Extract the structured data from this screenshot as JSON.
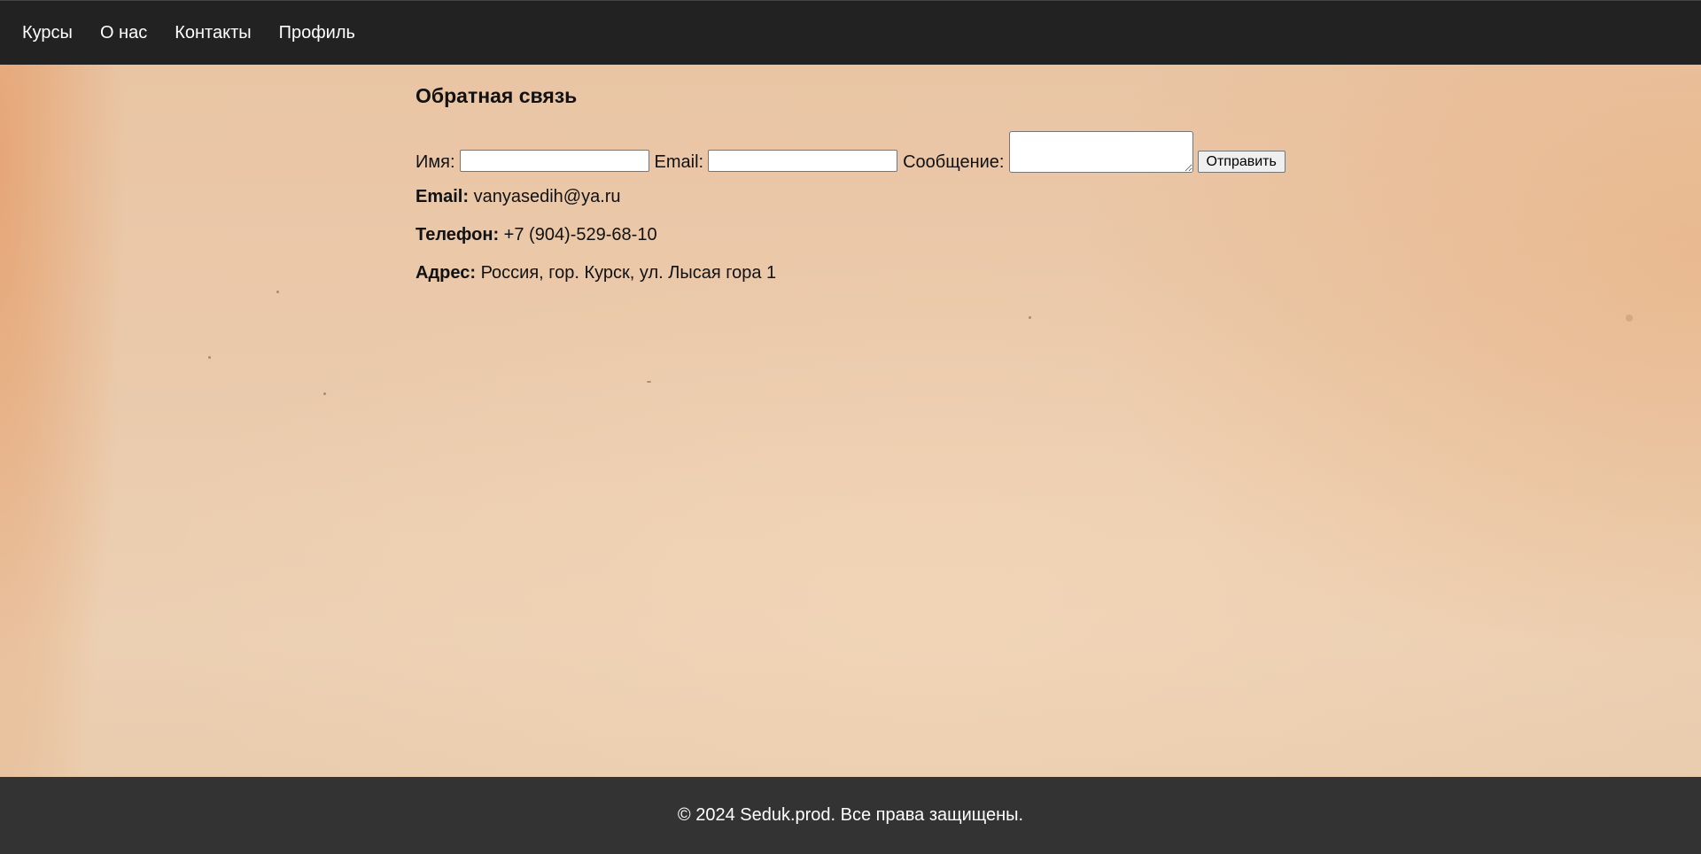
{
  "nav": {
    "items": [
      {
        "label": "Курсы"
      },
      {
        "label": "О нас"
      },
      {
        "label": "Контакты"
      },
      {
        "label": "Профиль"
      }
    ]
  },
  "feedback": {
    "title": "Обратная связь",
    "name_label": "Имя:",
    "name_value": "",
    "email_label": "Email:",
    "email_value": "",
    "message_label": "Сообщение:",
    "message_value": "",
    "submit_label": "Отправить"
  },
  "contacts": {
    "email_label": "Email:",
    "email_value": "vanyasedih@ya.ru",
    "phone_label": "Телефон:",
    "phone_value": "+7 (904)-529-68-10",
    "address_label": "Адрес:",
    "address_value": "Россия, гор. Курск, ул. Лысая гора 1"
  },
  "footer": {
    "text": "© 2024 Seduk.prod. Все права защищены."
  },
  "colors": {
    "nav_bg": "#222222",
    "footer_bg": "#333333",
    "page_bg": "#eac9aa"
  }
}
